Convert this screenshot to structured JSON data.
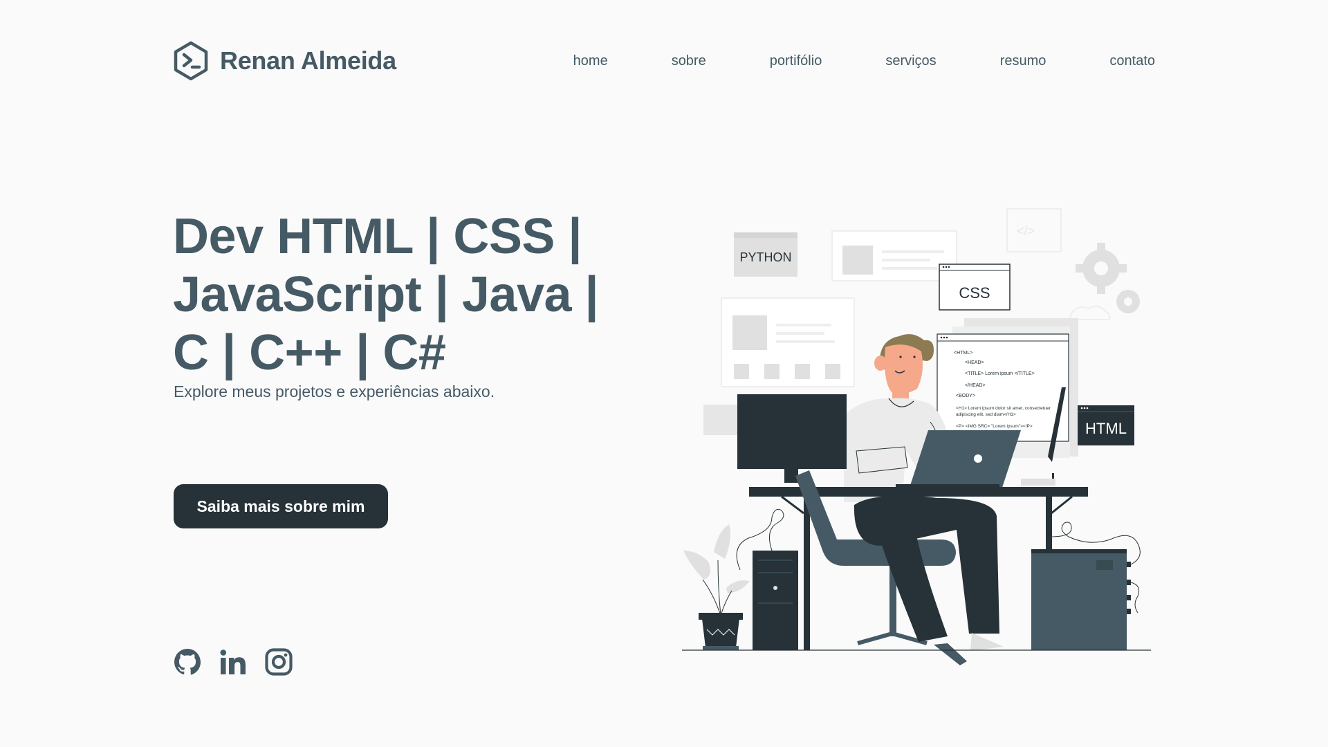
{
  "header": {
    "brand_name": "Renan Almeida",
    "brand_icon": "terminal-hexagon-icon",
    "nav": [
      {
        "label": "home"
      },
      {
        "label": "sobre"
      },
      {
        "label": "portifólio"
      },
      {
        "label": "serviços"
      },
      {
        "label": "resumo"
      },
      {
        "label": "contato"
      }
    ]
  },
  "hero": {
    "title_lines": [
      "Dev HTML | CSS |",
      "JavaScript | Java |",
      "C | C++ | C#"
    ],
    "subtitle": "Explore meus projetos e experiências abaixo.",
    "cta_label": "Saiba mais sobre mim"
  },
  "socials": [
    {
      "name": "github-icon"
    },
    {
      "name": "linkedin-icon"
    },
    {
      "name": "instagram-icon"
    }
  ],
  "illustration": {
    "cards": {
      "python": "PYTHON",
      "css": "CSS",
      "html": "HTML"
    },
    "code_lines": [
      "<HTML>",
      "<HEAD>",
      "<TITLE> Lorem ipsum </TITLE>",
      "</HEAD>",
      "<BODY>",
      "<H1> Lorem ipsum dolor sit amet, consectetuer",
      "adipiscing elit, sed diam</H1>",
      "<P> <IMG SRC= \"Lorem ipsum\"></P>"
    ]
  },
  "colors": {
    "background": "#fafafa",
    "text_primary": "#455a64",
    "dark": "#263238",
    "light_gray": "#e0e0e0"
  }
}
